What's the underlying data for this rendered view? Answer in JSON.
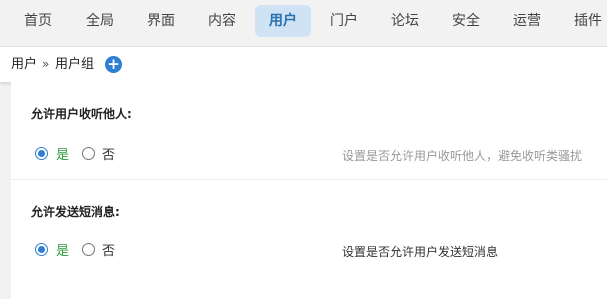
{
  "nav": {
    "items": [
      {
        "label": "首页"
      },
      {
        "label": "全局"
      },
      {
        "label": "界面"
      },
      {
        "label": "内容"
      },
      {
        "label": "用户"
      },
      {
        "label": "门户"
      },
      {
        "label": "论坛"
      },
      {
        "label": "安全"
      },
      {
        "label": "运营"
      },
      {
        "label": "插件"
      }
    ],
    "active": "用户"
  },
  "breadcrumb": {
    "items": [
      "用户",
      "用户组"
    ],
    "separator": "»"
  },
  "settings": [
    {
      "title": "允许用户收听他人:",
      "options": {
        "yes": "是",
        "no": "否"
      },
      "selected": "是",
      "hint": "设置是否允许用户收听他人，避免收听类骚扰"
    },
    {
      "title": "允许发送短消息:",
      "options": {
        "yes": "是",
        "no": "否"
      },
      "selected": "是",
      "hint": "设置是否允许用户发送短消息"
    }
  ],
  "colors": {
    "accent": "#2f7fd2",
    "active_tab_bg": "#cfe3f4",
    "yes_label": "#2e9b3a"
  }
}
